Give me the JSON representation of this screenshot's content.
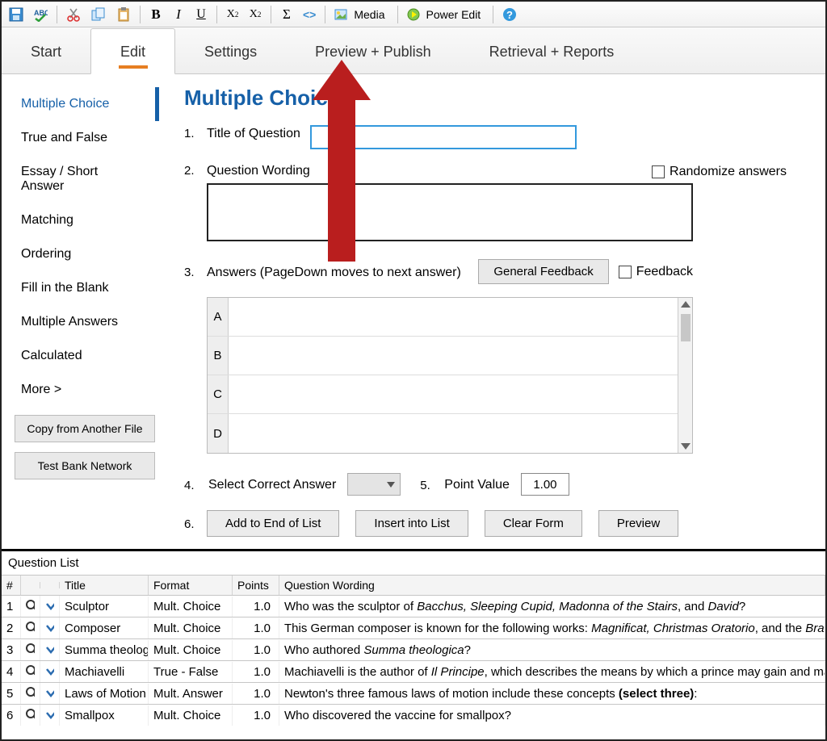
{
  "toolbar": {
    "media_label": "Media",
    "power_label": "Power Edit"
  },
  "tabs": [
    "Start",
    "Edit",
    "Settings",
    "Preview + Publish",
    "Retrieval + Reports"
  ],
  "activeTab": "Edit",
  "sidebar": {
    "items": [
      "Multiple Choice",
      "True and False",
      "Essay / Short Answer",
      "Matching",
      "Ordering",
      "Fill in the Blank",
      "Multiple Answers",
      "Calculated",
      "More >"
    ],
    "active": "Multiple Choice",
    "copy_btn": "Copy from Another File",
    "testbank_btn": "Test Bank Network"
  },
  "form": {
    "heading": "Multiple Choice",
    "num1": "1.",
    "label1": "Title of Question",
    "title_value": "",
    "num2": "2.",
    "label2": "Question Wording",
    "randomize_label": "Randomize answers",
    "num3": "3.",
    "label3": "Answers  (PageDown moves to next answer)",
    "general_feedback_btn": "General Feedback",
    "feedback_label": "Feedback",
    "answers": [
      "A",
      "B",
      "C",
      "D"
    ],
    "num4": "4.",
    "label4": "Select Correct Answer",
    "num5": "5.",
    "label5": "Point Value",
    "pv_value": "1.00",
    "num6": "6.",
    "add_btn": "Add to End of List",
    "insert_btn": "Insert into List",
    "clear_btn": "Clear Form",
    "preview_btn": "Preview"
  },
  "ql": {
    "title": "Question List",
    "head": {
      "num": "#",
      "title": "Title",
      "format": "Format",
      "points": "Points",
      "wording": "Question Wording"
    },
    "rows": [
      {
        "n": "1",
        "title": "Sculptor",
        "format": "Mult. Choice",
        "pts": "1.0",
        "w_pre": "Who was the sculptor of ",
        "w_ital": "Bacchus, Sleeping Cupid, Madonna of the Stairs",
        "w_mid": ", and ",
        "w_ital2": "David",
        "w_post": "?"
      },
      {
        "n": "2",
        "title": "Composer",
        "format": "Mult. Choice",
        "pts": "1.0",
        "w_pre": "This German composer is known for the following works: ",
        "w_ital": "Magnificat, Christmas Oratorio",
        "w_mid": ", and the ",
        "w_ital2": "Bran",
        "w_post": ""
      },
      {
        "n": "3",
        "title": "Summa theologi",
        "format": "Mult. Choice",
        "pts": "1.0",
        "w_pre": "Who authored ",
        "w_ital": "Summa theologica",
        "w_mid": "",
        "w_ital2": "",
        "w_post": "?"
      },
      {
        "n": "4",
        "title": "Machiavelli",
        "format": "True - False",
        "pts": "1.0",
        "w_pre": "Machiavelli is the author of ",
        "w_ital": "Il Principe",
        "w_mid": ", which describes the means by which a prince may gain and ma",
        "w_ital2": "",
        "w_post": ""
      },
      {
        "n": "5",
        "title": "Laws of Motion",
        "format": "Mult. Answer",
        "pts": "1.0",
        "w_pre": "Newton's three famous laws of motion include these concepts ",
        "w_bold": "(select three)",
        "w_post": ":"
      },
      {
        "n": "6",
        "title": "Smallpox",
        "format": "Mult. Choice",
        "pts": "1.0",
        "w_pre": "Who discovered the vaccine for smallpox?",
        "w_ital": "",
        "w_mid": "",
        "w_ital2": "",
        "w_post": ""
      }
    ]
  }
}
